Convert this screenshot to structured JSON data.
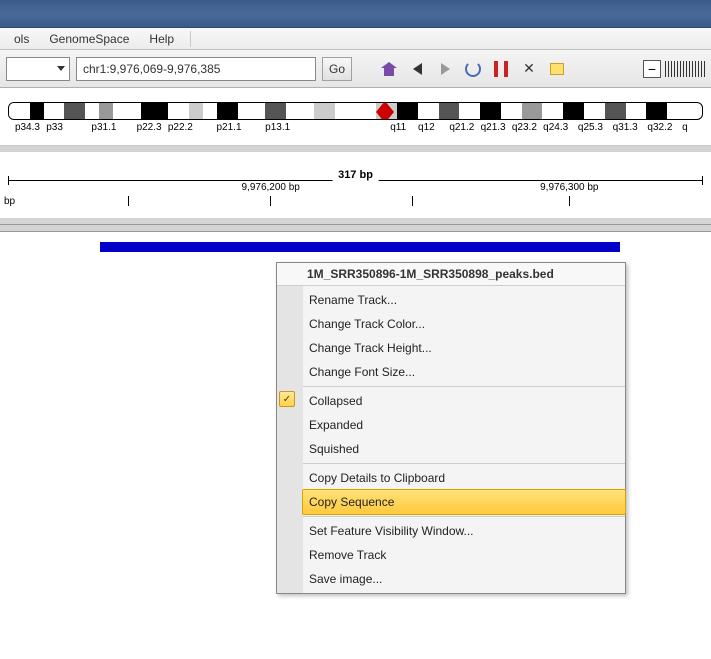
{
  "menubar": {
    "items": [
      "ols",
      "GenomeSpace",
      "Help"
    ]
  },
  "toolbar": {
    "location_value": "chr1:9,976,069-9,976,385",
    "go_label": "Go"
  },
  "ideogram": {
    "labels": [
      "p34.3",
      "p33",
      "p31.1",
      "p22.3",
      "p22.2",
      "p21.1",
      "p13.1",
      "q11",
      "q12",
      "q21.2",
      "q21.3",
      "q23.2",
      "q24.3",
      "q25.3",
      "q31.3",
      "q32.2",
      "q"
    ]
  },
  "ruler": {
    "span_label": "317 bp",
    "bp_unit": "bp",
    "ticks": [
      {
        "pos_pct": 18,
        "label": ""
      },
      {
        "pos_pct": 38,
        "label": "9,976,200 bp"
      },
      {
        "pos_pct": 58,
        "label": ""
      },
      {
        "pos_pct": 80,
        "label": "9,976,300 bp"
      }
    ]
  },
  "context_menu": {
    "header": "1M_SRR350896-1M_SRR350898_peaks.bed",
    "groups": [
      {
        "items": [
          {
            "label": "Rename Track...",
            "checked": false,
            "hl": false
          },
          {
            "label": "Change Track Color...",
            "checked": false,
            "hl": false
          },
          {
            "label": "Change Track Height...",
            "checked": false,
            "hl": false
          },
          {
            "label": "Change Font Size...",
            "checked": false,
            "hl": false
          }
        ]
      },
      {
        "items": [
          {
            "label": "Collapsed",
            "checked": true,
            "hl": false
          },
          {
            "label": "Expanded",
            "checked": false,
            "hl": false
          },
          {
            "label": "Squished",
            "checked": false,
            "hl": false
          }
        ]
      },
      {
        "items": [
          {
            "label": "Copy Details to Clipboard",
            "checked": false,
            "hl": false
          },
          {
            "label": "Copy Sequence",
            "checked": false,
            "hl": true
          }
        ]
      },
      {
        "items": [
          {
            "label": "Set Feature Visibility Window...",
            "checked": false,
            "hl": false
          },
          {
            "label": "Remove Track",
            "checked": false,
            "hl": false
          },
          {
            "label": "Save image...",
            "checked": false,
            "hl": false
          }
        ]
      }
    ]
  }
}
